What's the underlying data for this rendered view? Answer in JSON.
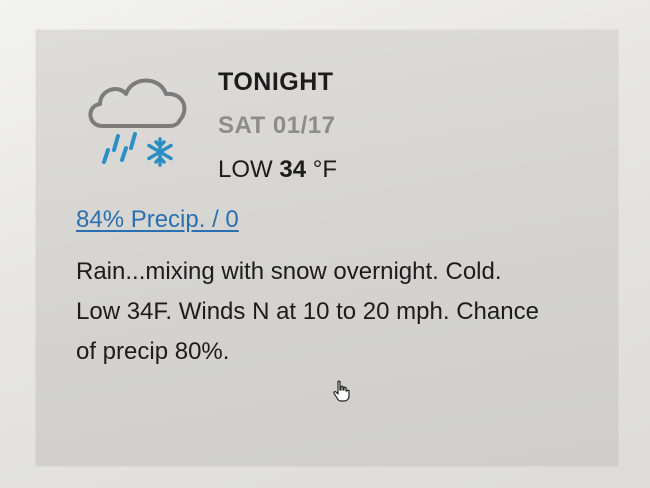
{
  "forecast": {
    "period": "TONIGHT",
    "date": "SAT 01/17",
    "low_prefix": "LOW",
    "low_value": "34",
    "low_unit": "°F",
    "precip_link": "84% Precip. / 0",
    "description": "Rain...mixing with snow overnight. Cold. Low 34F. Winds N at 10 to 20 mph. Chance of precip 80%."
  },
  "icons": {
    "weather": "cloud-rain-snow-icon",
    "cursor": "hand-cursor-icon"
  },
  "colors": {
    "accent": "#2a6fb2",
    "icon_blue": "#2a8fc4",
    "muted_text": "#8c8c8c",
    "text": "#1c1c1c"
  }
}
